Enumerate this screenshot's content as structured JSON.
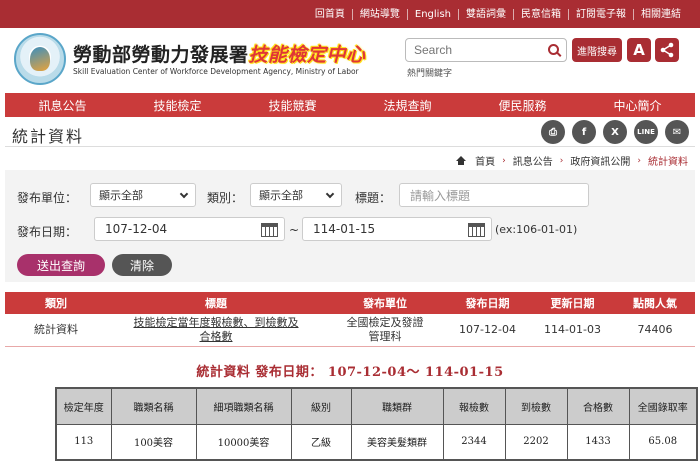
{
  "top_links": [
    "回首頁",
    "網站導覽",
    "English",
    "雙語詞彙",
    "民意信箱",
    "訂閱電子報",
    "相關連結"
  ],
  "brand": {
    "zh_main": "勞動部勞動力發展署",
    "zh_highlight": "技能檢定中心",
    "en": "Skill Evaluation Center of Workforce Development Agency, Ministry of Labor"
  },
  "search": {
    "placeholder": "Search",
    "hot_words": "熱門關鍵字",
    "advanced_label": "進階搜尋",
    "font_size_label": "A"
  },
  "nav": [
    "訊息公告",
    "技能檢定",
    "技能競賽",
    "法規查詢",
    "便民服務",
    "中心簡介"
  ],
  "page_title": "統計資料",
  "social": {
    "print": "⎙",
    "facebook": "f",
    "x": "X",
    "line": "LINE",
    "mail": "✉"
  },
  "breadcrumb": [
    "首頁",
    "訊息公告",
    "政府資訊公開",
    "統計資料"
  ],
  "filter": {
    "unit_label": "發布單位：",
    "unit_value": "顯示全部",
    "category_label": "類別：",
    "category_value": "顯示全部",
    "title_label": "標題：",
    "title_placeholder": "請輸入標題",
    "date_label": "發布日期：",
    "date_from": "107-12-04",
    "date_sep": "~",
    "date_to": "114-01-15",
    "date_hint": "(ex:106-01-01)",
    "submit_label": "送出查詢",
    "clear_label": "清除"
  },
  "results": {
    "headers": [
      "類別",
      "標題",
      "發布單位",
      "發布日期",
      "更新日期",
      "點閱人氣"
    ],
    "rows": [
      {
        "category": "統計資料",
        "title": "技能檢定當年度報檢數、到檢數及合格數",
        "unit": "全國檢定及發證管理科",
        "published": "107-12-04",
        "updated": "114-01-03",
        "views": "74406"
      }
    ]
  },
  "stats_subtitle": "統計資料 發布日期： 107-12-04～ 114-01-15",
  "stats": {
    "headers": [
      "檢定年度",
      "職類名稱",
      "細項職類名稱",
      "級別",
      "職類群",
      "報檢數",
      "到檢數",
      "合格數",
      "全國錄取率"
    ],
    "rows": [
      [
        "113",
        "100美容",
        "10000美容",
        "乙級",
        "美容美髮類群",
        "2344",
        "2202",
        "1433",
        "65.08"
      ]
    ]
  },
  "colors": {
    "brand_red": "#a92d33",
    "nav_red": "#ca3b3b",
    "submit_magenta": "#a8316b",
    "clear_gray": "#555555"
  }
}
